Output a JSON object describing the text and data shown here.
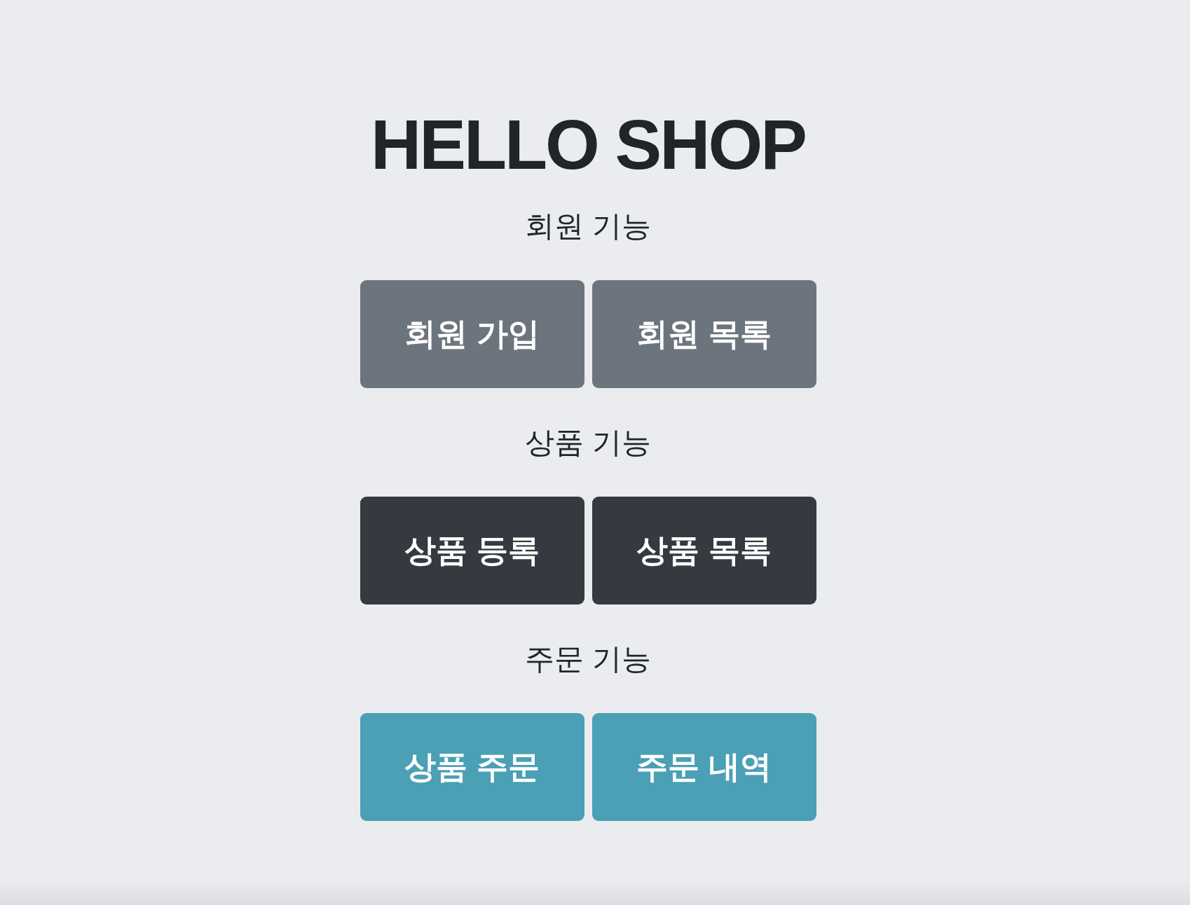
{
  "title": "HELLO SHOP",
  "sections": [
    {
      "heading": "회원 기능",
      "buttons": [
        "회원 가입",
        "회원 목록"
      ]
    },
    {
      "heading": "상품 기능",
      "buttons": [
        "상품 등록",
        "상품 목록"
      ]
    },
    {
      "heading": "주문 기능",
      "buttons": [
        "상품 주문",
        "주문 내역"
      ]
    }
  ]
}
